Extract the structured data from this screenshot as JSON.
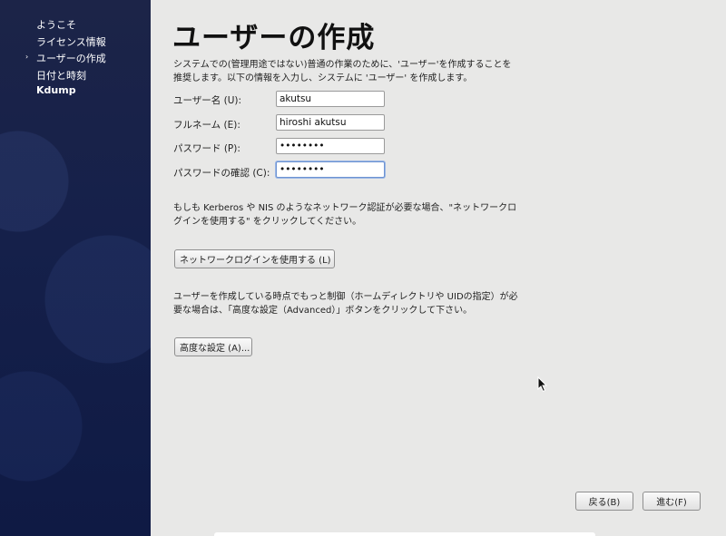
{
  "sidebar": {
    "items": [
      {
        "label": "ようこそ"
      },
      {
        "label": "ライセンス情報"
      },
      {
        "label": "ユーザーの作成"
      },
      {
        "label": "日付と時刻"
      },
      {
        "label": "Kdump"
      }
    ],
    "current_marker": "›"
  },
  "main": {
    "title": "ユーザーの作成",
    "intro_line1": "システムでの(管理用途ではない)普通の作業のために、'ユーザー'を作成することを",
    "intro_line2": "推奨します。以下の情報を入力し、システムに 'ユーザー' を作成します。",
    "form": {
      "username_label": "ユーザー名 (U):",
      "username_value": "akutsu",
      "fullname_label": "フルネーム (E):",
      "fullname_value": "hiroshi akutsu",
      "password_label": "パスワード (P):",
      "password_value": "••••••••",
      "confirm_label": "パスワードの確認 (C):",
      "confirm_value": "••••••••"
    },
    "network_text_line1": "もしも Kerberos や NIS のようなネットワーク認証が必要な場合、\"ネットワークロ",
    "network_text_line2": "グインを使用する\" をクリックしてください。",
    "network_button": "ネットワークログインを使用する (L)",
    "advanced_text_line1": "ユーザーを作成している時点でもっと制御（ホームディレクトリや UIDの指定）が必",
    "advanced_text_line2": "要な場合は、「高度な設定（Advanced）」ボタンをクリックして下さい。",
    "advanced_button": "高度な設定 (A)..."
  },
  "footer": {
    "back_button": "戻る(B)",
    "forward_button": "進む(F)"
  },
  "colors": {
    "sidebar_bg": "#15204a",
    "content_bg": "#e8e8e7",
    "focus_border": "#6e94d2"
  }
}
